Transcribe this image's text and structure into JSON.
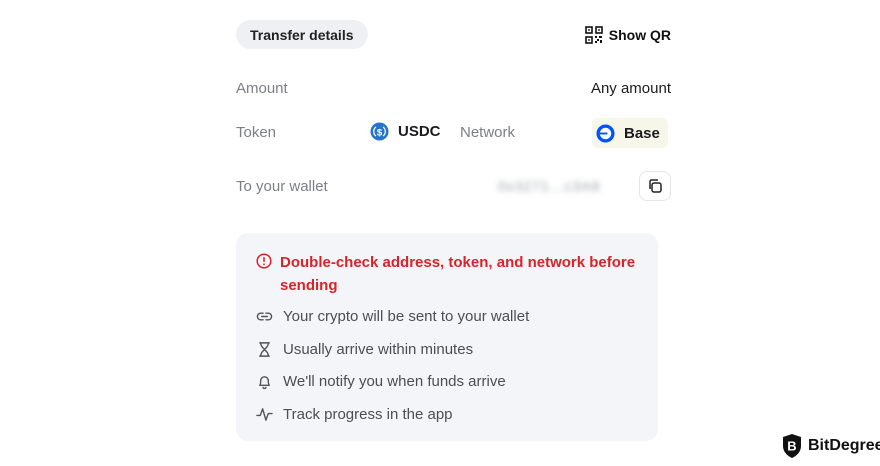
{
  "header": {
    "section_chip": "Transfer details",
    "show_qr_label": "Show QR"
  },
  "fields": {
    "amount_label": "Amount",
    "amount_value": "Any amount",
    "token_label": "Token",
    "token_value": "USDC",
    "network_label": "Network",
    "network_value": "Base",
    "wallet_label": "To your wallet",
    "wallet_value": "0x3271...c3A8"
  },
  "notice": {
    "warning": "Double-check address, token, and network before sending",
    "items": [
      {
        "icon": "link-icon",
        "text": "Your crypto will be sent to your wallet"
      },
      {
        "icon": "hourglass-icon",
        "text": "Usually arrive within minutes"
      },
      {
        "icon": "bell-icon",
        "text": "We'll notify you when funds arrive"
      },
      {
        "icon": "activity-icon",
        "text": "Track progress in the app"
      }
    ]
  },
  "watermark": {
    "brand": "BitDegree"
  },
  "colors": {
    "warning": "#d8232a",
    "usdc": "#2775ca",
    "base": "#0052ff",
    "panel": "#f3f5f8"
  }
}
